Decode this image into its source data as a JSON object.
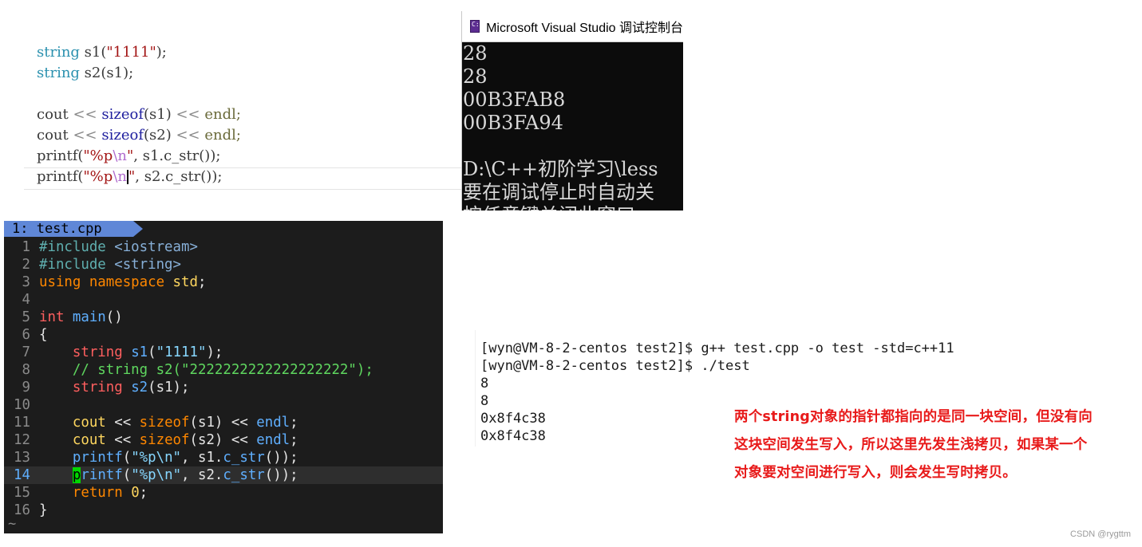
{
  "vs_editor": {
    "line1": {
      "type": "string",
      "var": " s1(",
      "str": "\"1111\"",
      "end": ");"
    },
    "line2": {
      "type": "string",
      "rest": " s2(s1);"
    },
    "line4": {
      "cout": "cout ",
      "op1": "<<",
      "fn": " sizeof",
      "arg": "(s1) ",
      "op2": "<<",
      "endl": " endl;"
    },
    "line5": {
      "cout": "cout ",
      "op1": "<<",
      "fn": " sizeof",
      "arg": "(s2) ",
      "op2": "<<",
      "endl": " endl;"
    },
    "line6": {
      "fn": "printf(",
      "str1": "\"%p",
      "esc": "\\n",
      "str2": "\"",
      "rest": ", s1.c_str());"
    },
    "line7": {
      "fn": "printf(",
      "str1": "\"%p",
      "esc": "\\n",
      "str2": "\"",
      "rest": ", s2.c_str());"
    }
  },
  "vs_console": {
    "title": "Microsoft Visual Studio 调试控制台",
    "icon": "console-app-icon",
    "lines": [
      "28",
      "28",
      "00B3FAB8",
      "00B3FA94",
      "",
      "D:\\C++初阶学习\\less",
      "要在调试停止时自动关",
      "按任意键关闭此窗口"
    ]
  },
  "vim": {
    "tab_label": "1: test.cpp",
    "lines": [
      {
        "n": "1",
        "parts": [
          [
            "v-pre",
            "#include "
          ],
          [
            "v-inc",
            "<iostream>"
          ]
        ]
      },
      {
        "n": "2",
        "parts": [
          [
            "v-pre",
            "#include "
          ],
          [
            "v-inc",
            "<string>"
          ]
        ]
      },
      {
        "n": "3",
        "parts": [
          [
            "v-kw",
            "using namespace "
          ],
          [
            "v-ns",
            "std"
          ],
          [
            "",
            "; "
          ]
        ]
      },
      {
        "n": "4",
        "parts": []
      },
      {
        "n": "5",
        "parts": [
          [
            "v-type",
            "int "
          ],
          [
            "v-fn",
            "main"
          ],
          [
            "",
            "()"
          ]
        ]
      },
      {
        "n": "6",
        "parts": [
          [
            "",
            "{"
          ]
        ]
      },
      {
        "n": "7",
        "parts": [
          [
            "",
            "    "
          ],
          [
            "v-type",
            "string "
          ],
          [
            "v-fn",
            "s1"
          ],
          [
            "",
            "("
          ],
          [
            "v-str",
            "\"1111\""
          ],
          [
            "",
            ");"
          ]
        ]
      },
      {
        "n": "8",
        "parts": [
          [
            "",
            "    "
          ],
          [
            "v-cmt",
            "// string s2(\"2222222222222222222\");"
          ]
        ]
      },
      {
        "n": "9",
        "parts": [
          [
            "",
            "    "
          ],
          [
            "v-type",
            "string "
          ],
          [
            "v-fn",
            "s2"
          ],
          [
            "",
            "(s1);"
          ]
        ]
      },
      {
        "n": "10",
        "parts": []
      },
      {
        "n": "11",
        "parts": [
          [
            "",
            "    "
          ],
          [
            "v-id",
            "cout"
          ],
          [
            "",
            " << "
          ],
          [
            "v-kw",
            "sizeof"
          ],
          [
            "",
            "(s1) << "
          ],
          [
            "v-fn",
            "endl"
          ],
          [
            "",
            ";"
          ]
        ]
      },
      {
        "n": "12",
        "parts": [
          [
            "",
            "    "
          ],
          [
            "v-id",
            "cout"
          ],
          [
            "",
            " << "
          ],
          [
            "v-kw",
            "sizeof"
          ],
          [
            "",
            "(s2) << "
          ],
          [
            "v-fn",
            "endl"
          ],
          [
            "",
            ";"
          ]
        ]
      },
      {
        "n": "13",
        "parts": [
          [
            "",
            "    "
          ],
          [
            "v-fn",
            "printf"
          ],
          [
            "",
            "("
          ],
          [
            "v-str",
            "\"%p\\n\""
          ],
          [
            "",
            ", s1."
          ],
          [
            "v-fn",
            "c_str"
          ],
          [
            "",
            "());"
          ]
        ]
      },
      {
        "n": "14",
        "cursor": true,
        "parts": [
          [
            "",
            "    "
          ],
          [
            "v-cursor",
            "p"
          ],
          [
            "v-fn",
            "rintf"
          ],
          [
            "",
            "("
          ],
          [
            "v-str",
            "\"%p\\n\""
          ],
          [
            "",
            ", s2."
          ],
          [
            "v-fn",
            "c_str"
          ],
          [
            "",
            "());"
          ]
        ]
      },
      {
        "n": "15",
        "parts": [
          [
            "",
            "    "
          ],
          [
            "v-kw",
            "return "
          ],
          [
            "v-num",
            "0"
          ],
          [
            "",
            ";"
          ]
        ]
      },
      {
        "n": "16",
        "parts": [
          [
            "",
            "}"
          ]
        ]
      }
    ],
    "tilde": "~"
  },
  "terminal": {
    "lines": [
      "[wyn@VM-8-2-centos test2]$ g++ test.cpp -o test -std=c++11",
      "[wyn@VM-8-2-centos test2]$ ./test",
      "8",
      "8",
      "0x8f4c38",
      "0x8f4c38"
    ]
  },
  "annotation": {
    "line1": "两个string对象的指针都指向的是同一块空间，但没有向",
    "line2": "这块空间发生写入，所以这里先发生浅拷贝，如果某一个",
    "line3": "对象要对空间进行写入，则会发生写时拷贝。"
  },
  "watermark": "CSDN @rygttm",
  "colors": {
    "annotation": "#e81a1a",
    "vim_tab": "#5f87d7",
    "vim_bg": "#1c1c1c",
    "console_bg": "#0c0c0c"
  }
}
